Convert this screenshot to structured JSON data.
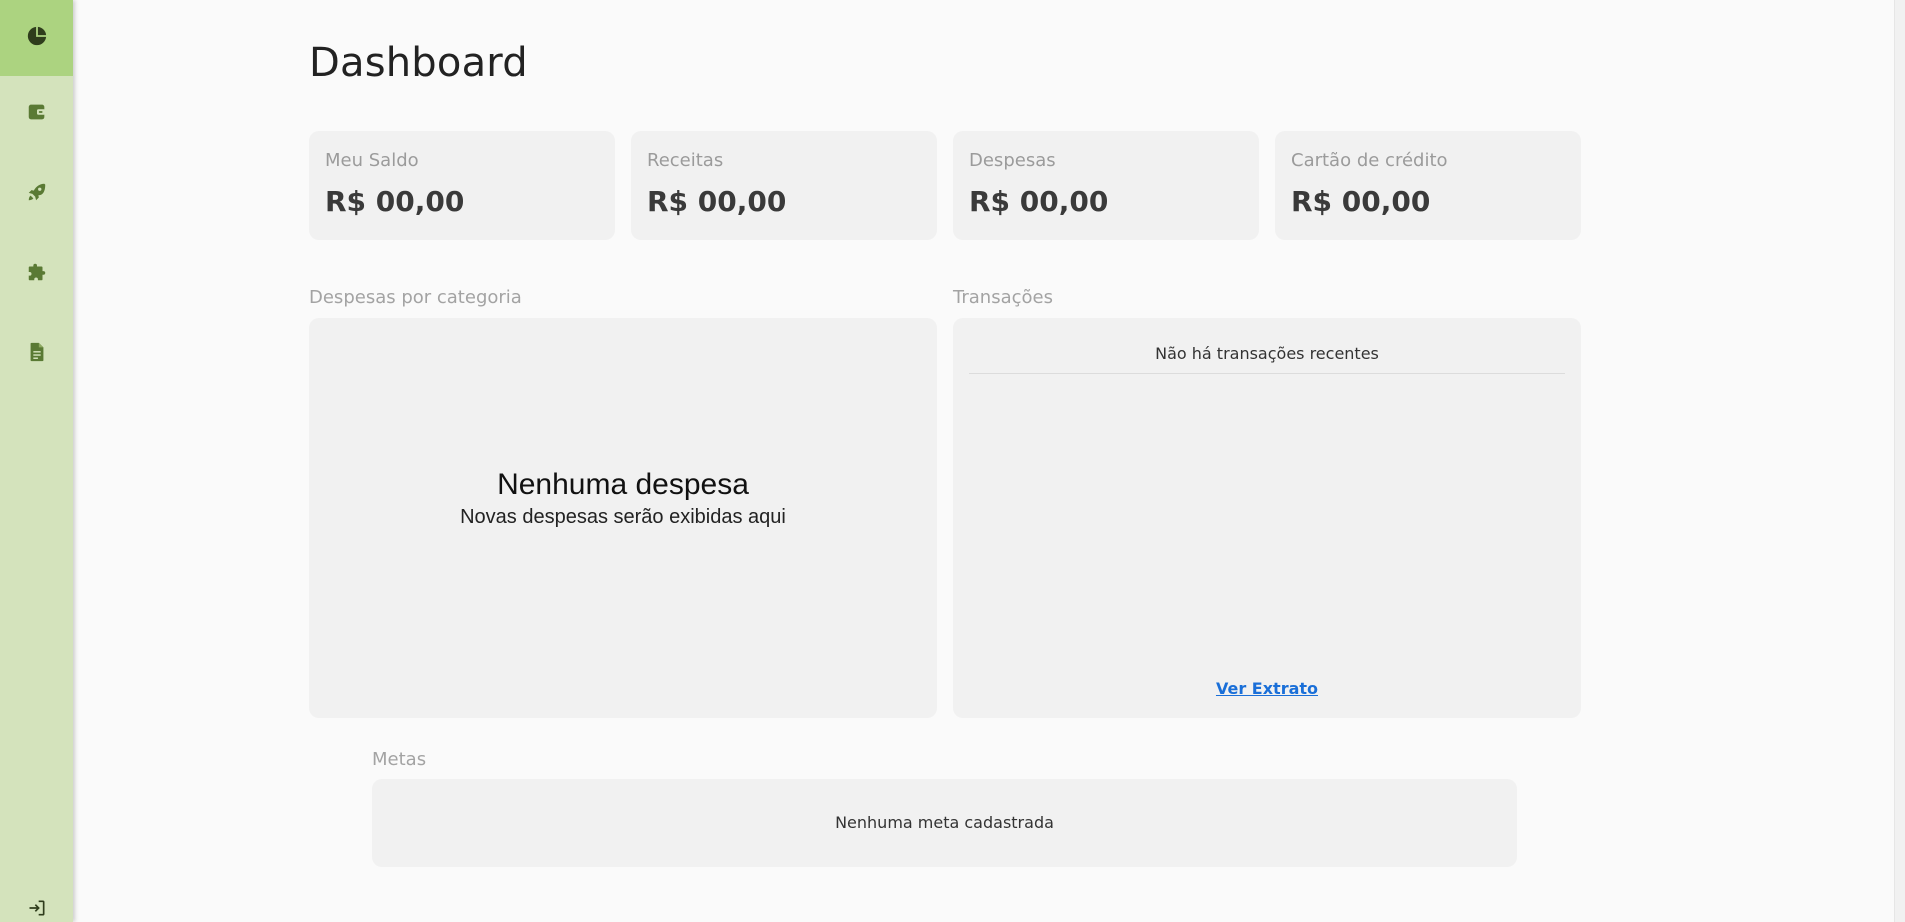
{
  "page": {
    "title": "Dashboard"
  },
  "sidebar": {
    "items": [
      {
        "icon": "pie-chart-icon",
        "active": true
      },
      {
        "icon": "wallet-icon",
        "active": false
      },
      {
        "icon": "rocket-icon",
        "active": false
      },
      {
        "icon": "puzzle-icon",
        "active": false
      },
      {
        "icon": "document-icon",
        "active": false
      }
    ],
    "logout_icon": "logout-icon",
    "active_color": "#acd380",
    "background_color": "#d4e3bc",
    "icon_color": "#5a7a34"
  },
  "summary_cards": [
    {
      "label": "Meu Saldo",
      "value": "R$ 00,00"
    },
    {
      "label": "Receitas",
      "value": "R$ 00,00"
    },
    {
      "label": "Despesas",
      "value": "R$ 00,00"
    },
    {
      "label": "Cartão de crédito",
      "value": "R$ 00,00"
    }
  ],
  "expenses_by_category": {
    "heading": "Despesas por categoria",
    "empty_title": "Nenhuma despesa",
    "empty_subtitle": "Novas despesas serão exibidas aqui"
  },
  "transactions": {
    "heading": "Transações",
    "empty_text": "Não há transações recentes",
    "link_label": "Ver Extrato",
    "link_color": "#1a6fd8"
  },
  "goals": {
    "heading": "Metas",
    "empty_text": "Nenhuma meta cadastrada"
  }
}
